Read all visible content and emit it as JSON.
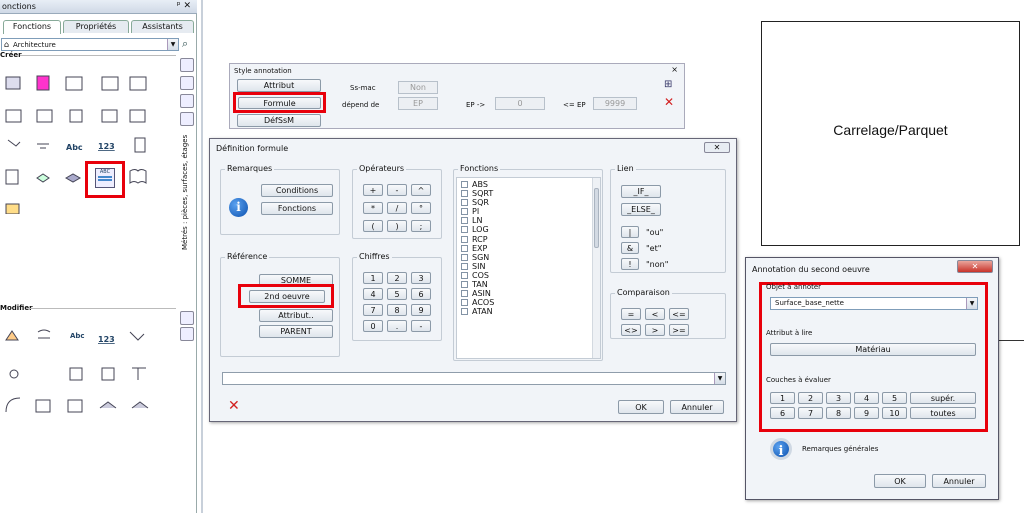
{
  "left_panel": {
    "title": "onctions",
    "pin_close": "1 ×",
    "tabs": [
      "Fonctions",
      "Propriétés",
      "Assistants"
    ],
    "category": "Architecture",
    "section_create": "Créer",
    "section_modify": "Modifier",
    "vertical_label": "Métrés : pièces, surfaces, étages",
    "create_text_icons": {
      "abc": "Abc",
      "num": "123"
    },
    "modify_text_icons": {
      "abc": "Abc",
      "num": "123"
    }
  },
  "style_annotation": {
    "title": "Style annotation",
    "close": "×",
    "btn_attribut": "Attribut",
    "btn_formule": "Formule",
    "btn_defssm": "DéfSsM",
    "lbl_ssmac": "Ss-mac",
    "val_ssmac": "Non",
    "lbl_depend": "dépend de",
    "val_depend": "EP",
    "lbl_ep_arrow": "EP ->",
    "val_min": "0",
    "lbl_le_ep": "<= EP",
    "val_max": "9999"
  },
  "formula_dialog": {
    "title": "Définition formule",
    "group_remarques": "Remarques",
    "btn_conditions": "Conditions",
    "btn_fonctions": "Fonctions",
    "group_reference": "Référence",
    "btn_somme": "SOMME",
    "btn_2nd": "2nd oeuvre",
    "btn_attribut": "Attribut..",
    "btn_parent": "PARENT",
    "group_operateurs": "Opérateurs",
    "ops": [
      "+",
      "-",
      "^",
      "*",
      "/",
      "°",
      "(",
      ")",
      ";"
    ],
    "group_chiffres": "Chiffres",
    "digits": [
      "1",
      "2",
      "3",
      "4",
      "5",
      "6",
      "7",
      "8",
      "9",
      "0",
      ".",
      "-"
    ],
    "group_fonctions": "Fonctions",
    "functions": [
      "ABS",
      "SQRT",
      "SQR",
      "PI",
      "LN",
      "LOG",
      "RCP",
      "EXP",
      "SGN",
      "SIN",
      "COS",
      "TAN",
      "ASIN",
      "ACOS",
      "ATAN"
    ],
    "group_lien": "Lien",
    "btn_if": "_IF_",
    "btn_else": "_ELSE_",
    "link_or": "|",
    "link_or_lbl": "\"ou\"",
    "link_and": "&",
    "link_and_lbl": "\"et\"",
    "link_not": "!",
    "link_not_lbl": "\"non\"",
    "group_comparaison": "Comparaison",
    "cmp": [
      "=",
      "<",
      "<=",
      "<>",
      ">",
      ">="
    ],
    "formula_value": "",
    "btn_ok": "OK",
    "btn_cancel": "Annuler"
  },
  "preview_box": {
    "text": "Carrelage/Parquet"
  },
  "annot_dialog": {
    "title": "Annotation du second oeuvre",
    "group_objet": "Objet à annoter",
    "objet_value": "Surface_base_nette",
    "group_attribut": "Attribut à lire",
    "attribut_btn": "Matériau",
    "group_couches": "Couches à évaluer",
    "layers": [
      "1",
      "2",
      "3",
      "4",
      "5",
      "6",
      "7",
      "8",
      "9",
      "10"
    ],
    "btn_super": "supér.",
    "btn_toutes": "toutes",
    "remarks": "Remarques générales",
    "btn_ok": "OK",
    "btn_cancel": "Annuler"
  },
  "colors": {
    "highlight": "#e8000b",
    "dialog_bg": "#f1f4f8",
    "cancel_x": "#d22020"
  }
}
